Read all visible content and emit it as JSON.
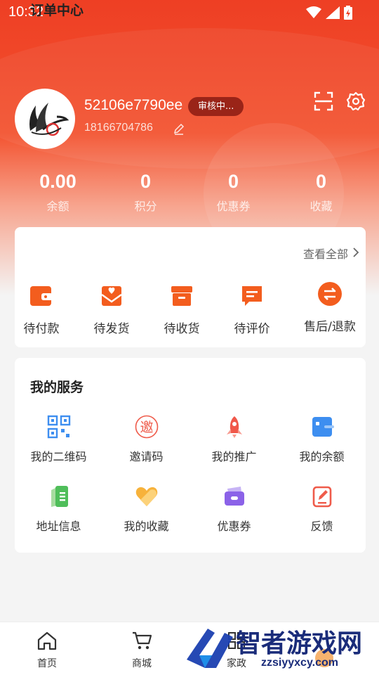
{
  "status_bar": {
    "time": "10:32"
  },
  "profile": {
    "username": "52106e7790ee",
    "badge": "审核中...",
    "phone": "18166704786"
  },
  "stats": [
    {
      "value": "0.00",
      "label": "余额"
    },
    {
      "value": "0",
      "label": "积分"
    },
    {
      "value": "0",
      "label": "优惠券"
    },
    {
      "value": "0",
      "label": "收藏"
    }
  ],
  "orders": {
    "title": "订单中心",
    "see_all": "查看全部",
    "items": [
      {
        "label": "待付款",
        "icon": "wallet-icon"
      },
      {
        "label": "待发货",
        "icon": "package-heart-icon"
      },
      {
        "label": "待收货",
        "icon": "box-icon"
      },
      {
        "label": "待评价",
        "icon": "comment-icon"
      },
      {
        "label": "售后/退款",
        "icon": "exchange-icon"
      }
    ]
  },
  "services": {
    "title": "我的服务",
    "items": [
      {
        "label": "我的二维码",
        "icon": "qrcode-icon"
      },
      {
        "label": "邀请码",
        "icon": "invite-stamp-icon",
        "glyph": "邀"
      },
      {
        "label": "我的推广",
        "icon": "rocket-icon"
      },
      {
        "label": "我的余额",
        "icon": "balance-card-icon"
      },
      {
        "label": "地址信息",
        "icon": "address-book-icon"
      },
      {
        "label": "我的收藏",
        "icon": "heart-icon"
      },
      {
        "label": "优惠券",
        "icon": "coupon-wallet-icon"
      },
      {
        "label": "反馈",
        "icon": "feedback-edit-icon"
      }
    ]
  },
  "tabbar": [
    {
      "label": "首页",
      "icon": "home-icon"
    },
    {
      "label": "商城",
      "icon": "cart-icon"
    },
    {
      "label": "家政",
      "icon": "grid-icon"
    }
  ],
  "watermark": {
    "text": "智者游戏网",
    "url": "zzsiyyxcy.com"
  },
  "colors": {
    "brand": "#ee3f24",
    "orange": "#f35d1e",
    "blue": "#3d8ef0"
  }
}
